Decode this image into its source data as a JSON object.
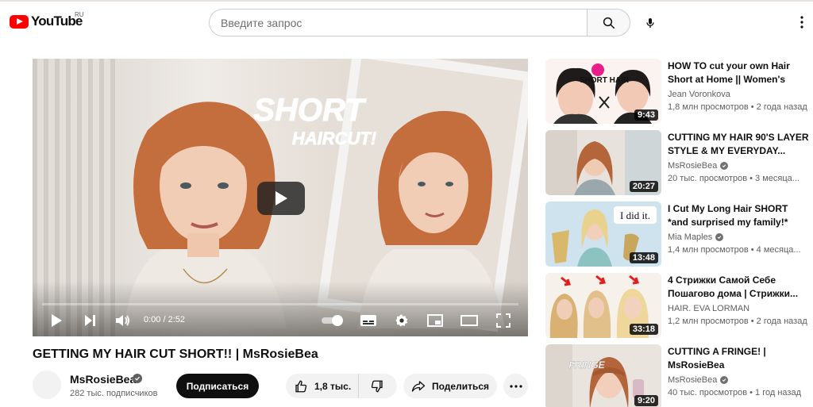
{
  "header": {
    "logo_text": "YouTube",
    "region": "RU",
    "search_placeholder": "Введите запрос",
    "icons": [
      "youtube-logo",
      "search-icon",
      "mic-icon",
      "more-vert-icon"
    ]
  },
  "player": {
    "overlay_title_line1": "SHORT",
    "overlay_title_line2": "HAIRCUT!",
    "time": "0:00 / 2:52",
    "progress": 0.0,
    "controls": [
      "play-icon",
      "next-icon",
      "volume-icon",
      "autoplay-toggle",
      "subtitles-icon",
      "settings-icon",
      "miniplayer-icon",
      "theater-icon",
      "fullscreen-icon"
    ]
  },
  "video": {
    "title": "GETTING MY HAIR CUT SHORT!! | MsRosieBea",
    "channel": "MsRosieBea",
    "subscribers": "282 тыс. подписчиков",
    "subscribe_label": "Подписаться",
    "likes": "1,8 тыс.",
    "share_label": "Поделиться"
  },
  "recommendations": [
    {
      "title": "HOW TO cut your own Hair Short at Home || Women's DIY...",
      "channel": "Jean Voronkova",
      "verified": false,
      "meta": "1,8 млн просмотров • 2 года назад",
      "duration": "9:43",
      "thumb_text": "SHORT HAIR"
    },
    {
      "title": "CUTTING MY HAIR 90'S LAYER STYLE & MY EVERYDAY...",
      "channel": "MsRosieBea",
      "verified": true,
      "meta": "20 тыс. просмотров • 3 месяца...",
      "duration": "20:27",
      "thumb_text": ""
    },
    {
      "title": "I Cut My Long Hair SHORT *and surprised my family!*",
      "channel": "Mia Maples",
      "verified": true,
      "meta": "1,4 млн просмотров • 4 месяца...",
      "duration": "13:48",
      "thumb_text": "I did it."
    },
    {
      "title": "4 Стрижки Самой Себе Пошагово дома | Стрижки...",
      "channel": "HAIR. EVA LORMAN",
      "verified": false,
      "meta": "1,2 млн просмотров • 2 года назад",
      "duration": "33:18",
      "thumb_text": ""
    },
    {
      "title": "CUTTING A FRINGE! | MsRosieBea",
      "channel": "MsRosieBea",
      "verified": true,
      "meta": "40 тыс. просмотров • 1 год назад",
      "duration": "9:20",
      "thumb_text": "FRINGE"
    }
  ],
  "colors": {
    "brand_red": "#ff0000",
    "text_primary": "#0f0f0f",
    "text_secondary": "#606060",
    "chip_bg": "#f2f2f2"
  }
}
